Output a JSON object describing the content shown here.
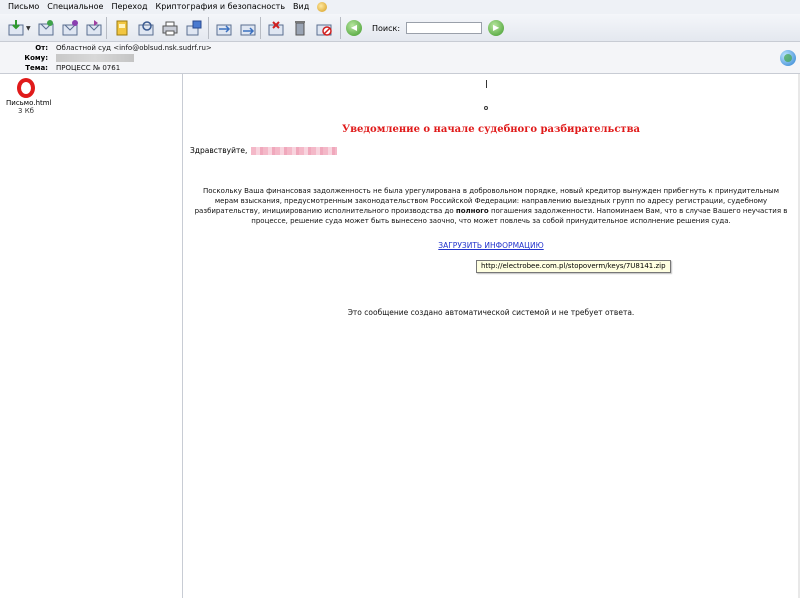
{
  "menu": {
    "items": [
      "Письмо",
      "Специальное",
      "Переход",
      "Криптография и безопасность",
      "Вид"
    ]
  },
  "toolbar": {
    "search_label": "Поиск:",
    "search_value": ""
  },
  "header": {
    "from_label": "От:",
    "from_value": "Областной суд <info@oblsud.nsk.sudrf.ru>",
    "to_label": "Кому:",
    "subject_label": "Тема:",
    "subject_value": "ПРОЦЕСС № 0761"
  },
  "attachment": {
    "name": "Письмо.html",
    "size": "3 Кб"
  },
  "message": {
    "title": "Уведомление о начале судебного разбирательства",
    "greeting": "Здравствуйте,",
    "paragraph_1": "Поскольку Ваша финансовая задолженность не была урегулирована в добровольном порядке, новый кредитор вынужден прибегнуть к принудительным мерам взыскания, предусмотренным законодательством Российской Федерации: направлению выездных групп по адресу регистрации, судебному разбирательству, инициированию исполнительного производства до",
    "paragraph_bold": "полного",
    "paragraph_2": "погашения задолженности. Напоминаем Вам, что в случае Вашего неучастия в процессе, решение суда может быть вынесено заочно, что может повлечь за собой принудительное исполнение решения суда.",
    "link_text": "ЗАГРУЗИТЬ ИНФОРМАЦИЮ",
    "tooltip": "http://electrobee.com.pl/stopoverm/keys/7U8141.zip",
    "footer": "Это сообщение создано автоматической системой и не требует ответа."
  },
  "colors": {
    "title_red": "#e01a1a",
    "link_blue": "#2233cc"
  }
}
